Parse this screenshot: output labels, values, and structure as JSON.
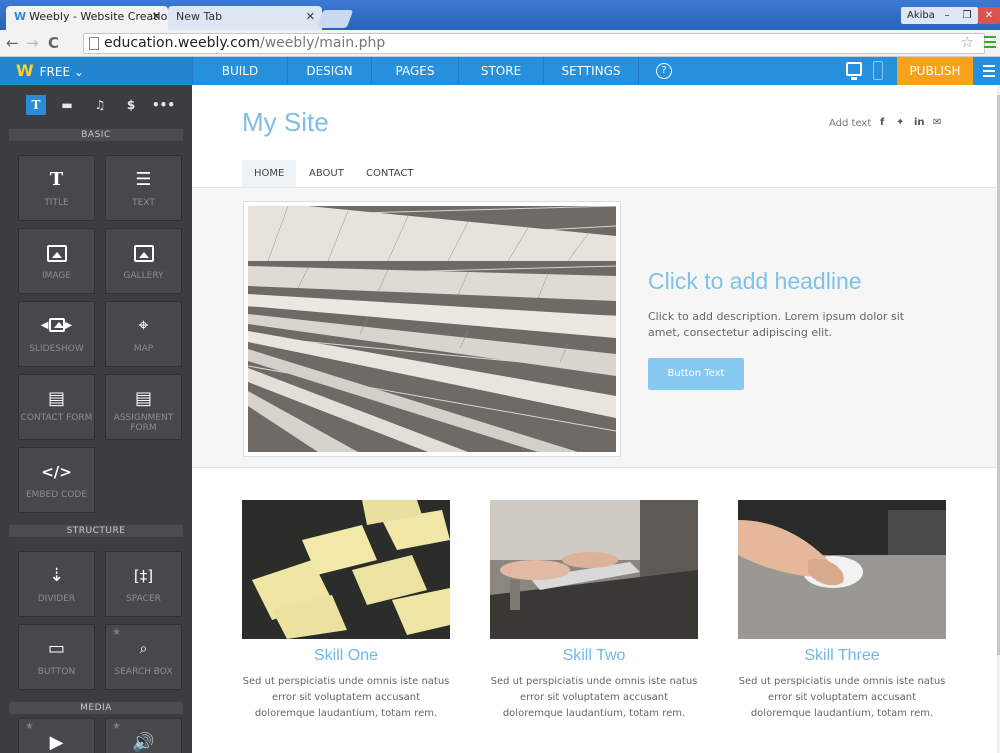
{
  "browser": {
    "tab1": "Weebly - Website Creatio",
    "tab2": "New Tab",
    "user": "Akiba",
    "url_host": "education.weebly.com",
    "url_path": "/weebly/main.php"
  },
  "topbar": {
    "plan": "FREE",
    "tabs": [
      "BUILD",
      "DESIGN",
      "PAGES",
      "STORE",
      "SETTINGS"
    ],
    "publish": "PUBLISH",
    "brand_colors": {
      "bar": "#2690dd",
      "publish": "#f7a21b"
    }
  },
  "sidebar": {
    "tool_icons": [
      "T",
      "▬",
      "♫",
      "$",
      "•••"
    ],
    "sections": {
      "basic": "BASIC",
      "structure": "STRUCTURE",
      "media": "MEDIA"
    },
    "basic": [
      {
        "label": "TITLE",
        "icon": "title-icon"
      },
      {
        "label": "TEXT",
        "icon": "text-icon"
      },
      {
        "label": "IMAGE",
        "icon": "image-icon"
      },
      {
        "label": "GALLERY",
        "icon": "gallery-icon"
      },
      {
        "label": "SLIDESHOW",
        "icon": "slideshow-icon"
      },
      {
        "label": "MAP",
        "icon": "map-icon"
      },
      {
        "label": "CONTACT FORM",
        "icon": "form-icon"
      },
      {
        "label": "ASSIGNMENT FORM",
        "icon": "form-icon"
      },
      {
        "label": "EMBED CODE",
        "icon": "code-icon"
      }
    ],
    "structure": [
      {
        "label": "DIVIDER",
        "icon": "divider-icon"
      },
      {
        "label": "SPACER",
        "icon": "spacer-icon"
      },
      {
        "label": "BUTTON",
        "icon": "button-icon"
      },
      {
        "label": "SEARCH BOX",
        "icon": "search-icon"
      }
    ]
  },
  "site": {
    "title": "My Site",
    "add_text": "Add text",
    "social": [
      "f",
      "🐦",
      "in",
      "✉"
    ],
    "nav": [
      "HOME",
      "ABOUT",
      "CONTACT"
    ],
    "headline": "Click to add headline",
    "description": "Click to add description. Lorem ipsum dolor sit amet, consectetur adipiscing elit.",
    "button": "Button Text",
    "skills": [
      {
        "title": "Skill One",
        "text": "Sed ut perspiciatis unde omnis iste natus error sit voluptatem accusant doloremque laudantium, totam rem."
      },
      {
        "title": "Skill Two",
        "text": "Sed ut perspiciatis unde omnis iste natus error sit voluptatem accusant doloremque laudantium, totam rem."
      },
      {
        "title": "Skill Three",
        "text": "Sed ut perspiciatis unde omnis iste natus error sit voluptatem accusant doloremque laudantium, totam rem."
      }
    ]
  }
}
